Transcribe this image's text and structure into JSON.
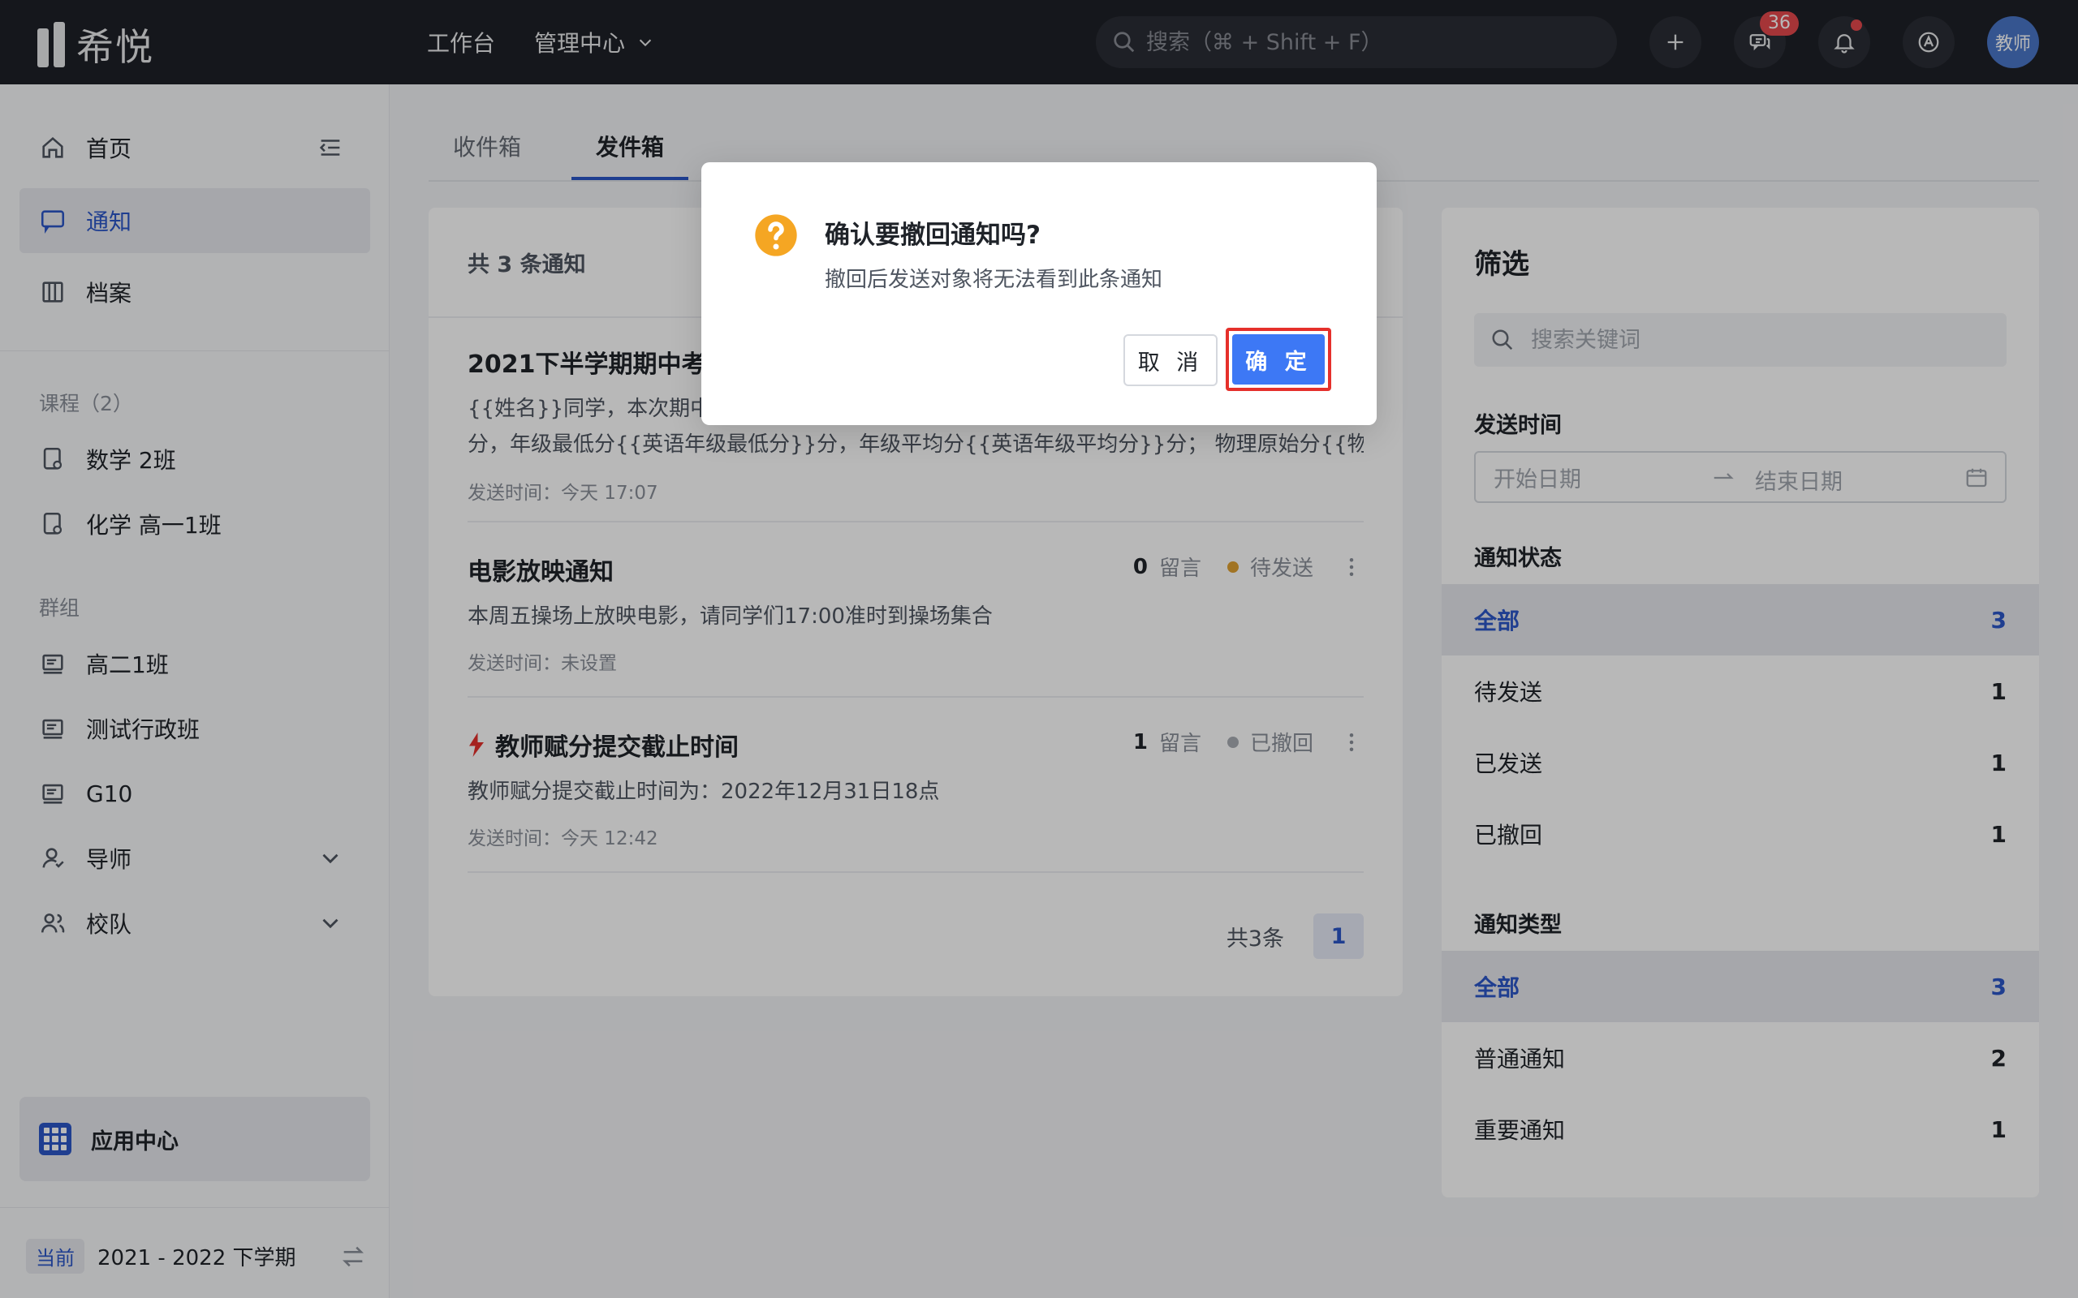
{
  "brand": {
    "name": "希悦"
  },
  "topnav": {
    "items": [
      {
        "label": "工作台"
      },
      {
        "label": "管理中心"
      }
    ]
  },
  "search": {
    "placeholder": "搜索（⌘ + Shift + F）"
  },
  "header_icons": {
    "messages_badge": "36",
    "avatar_label": "教师"
  },
  "sidebar": {
    "home": "首页",
    "notice": "通知",
    "archive": "档案",
    "courses_title": "课程（2）",
    "courses": [
      "数学 2班",
      "化学 高一1班"
    ],
    "groups_title": "群组",
    "groups": [
      "高二1班",
      "测试行政班",
      "G10"
    ],
    "mentor": "导师",
    "team": "校队",
    "app_center": "应用中心",
    "term_tag": "当前",
    "term_label": "2021 - 2022 下学期"
  },
  "tabs": {
    "inbox": "收件箱",
    "outbox": "发件箱"
  },
  "list": {
    "count_label": "共 3 条通知",
    "notices": [
      {
        "title": "2021下半学期期中考",
        "body": "{{姓名}}同学，本次期中考",
        "body2": "分，年级最低分{{英语年级最低分}}分，年级平均分{{英语年级平均分}}分； 物理原始分{{物理…",
        "time": "发送时间：今天 17:07"
      },
      {
        "title": "电影放映通知",
        "comments": "0",
        "comments_label": "留言",
        "status": "待发送",
        "body": "本周五操场上放映电影，请同学们17:00准时到操场集合",
        "time": "发送时间：未设置"
      },
      {
        "title": "教师赋分提交截止时间",
        "comments": "1",
        "comments_label": "留言",
        "status": "已撤回",
        "body": "教师赋分提交截止时间为：2022年12月31日18点",
        "time": "发送时间：今天 12:42"
      }
    ],
    "pager_total": "共3条",
    "pager_page": "1"
  },
  "filter": {
    "title": "筛选",
    "search_placeholder": "搜索关键词",
    "send_time_label": "发送时间",
    "start_placeholder": "开始日期",
    "end_placeholder": "结束日期",
    "status_label": "通知状态",
    "status_rows": [
      {
        "label": "全部",
        "count": "3"
      },
      {
        "label": "待发送",
        "count": "1"
      },
      {
        "label": "已发送",
        "count": "1"
      },
      {
        "label": "已撤回",
        "count": "1"
      }
    ],
    "type_label": "通知类型",
    "type_rows": [
      {
        "label": "全部",
        "count": "3"
      },
      {
        "label": "普通通知",
        "count": "2"
      },
      {
        "label": "重要通知",
        "count": "1"
      }
    ]
  },
  "modal": {
    "title": "确认要撤回通知吗?",
    "desc": "撤回后发送对象将无法看到此条通知",
    "cancel": "取 消",
    "confirm": "确 定"
  },
  "colors": {
    "accent": "#2b56c8",
    "confirm": "#3d78f5",
    "warning": "#f5a623",
    "highlight": "#e5302b"
  }
}
